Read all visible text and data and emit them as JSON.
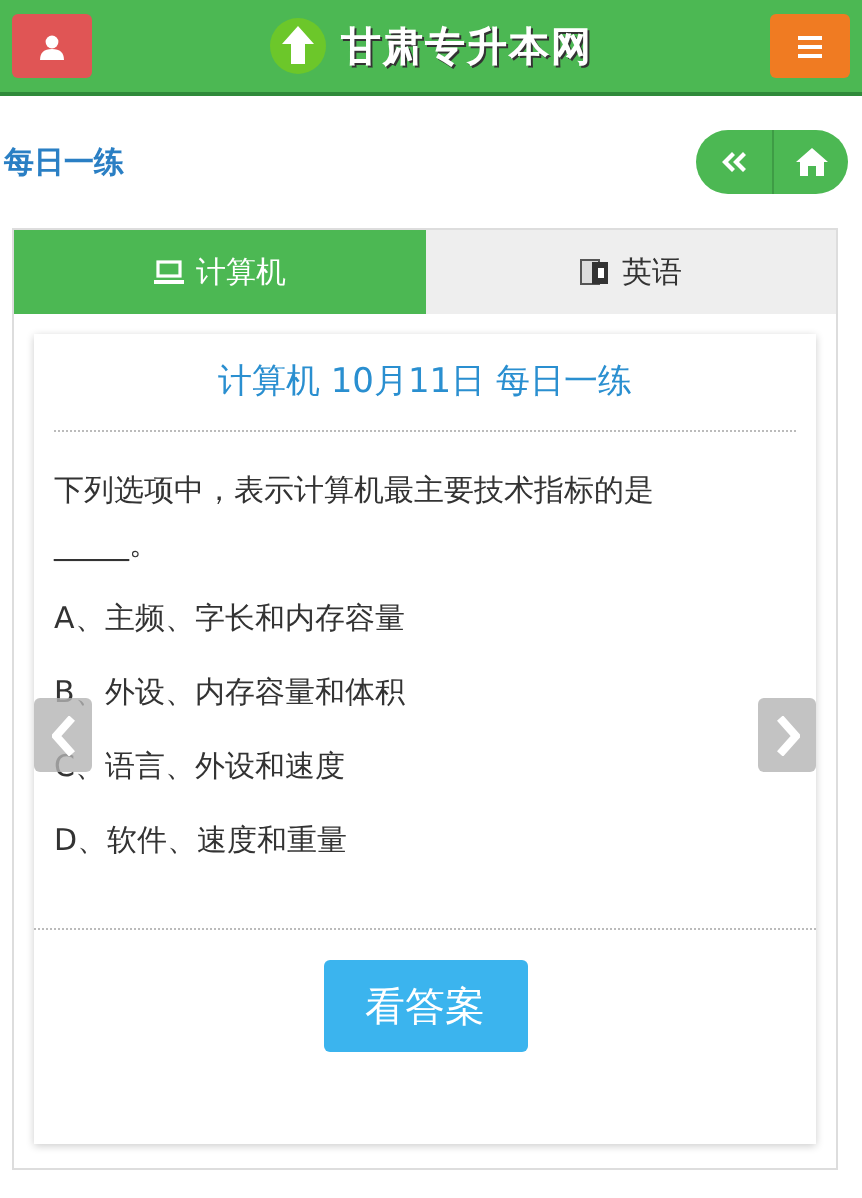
{
  "header": {
    "logo_text": "甘肃专升本网"
  },
  "page_title": "每日一练",
  "tabs": [
    {
      "label": "计算机",
      "kind": "laptop",
      "selected": true
    },
    {
      "label": "英语",
      "kind": "book",
      "selected": false
    }
  ],
  "card": {
    "title": "计算机 10月11日 每日一练",
    "question": "下列选项中，表示计算机最主要技术指标的是_____。",
    "options": [
      "A、主频、字长和内存容量",
      "B、外设、内存容量和体积",
      "C、语言、外设和速度",
      "D、软件、速度和重量"
    ],
    "answer_button": "看答案"
  }
}
